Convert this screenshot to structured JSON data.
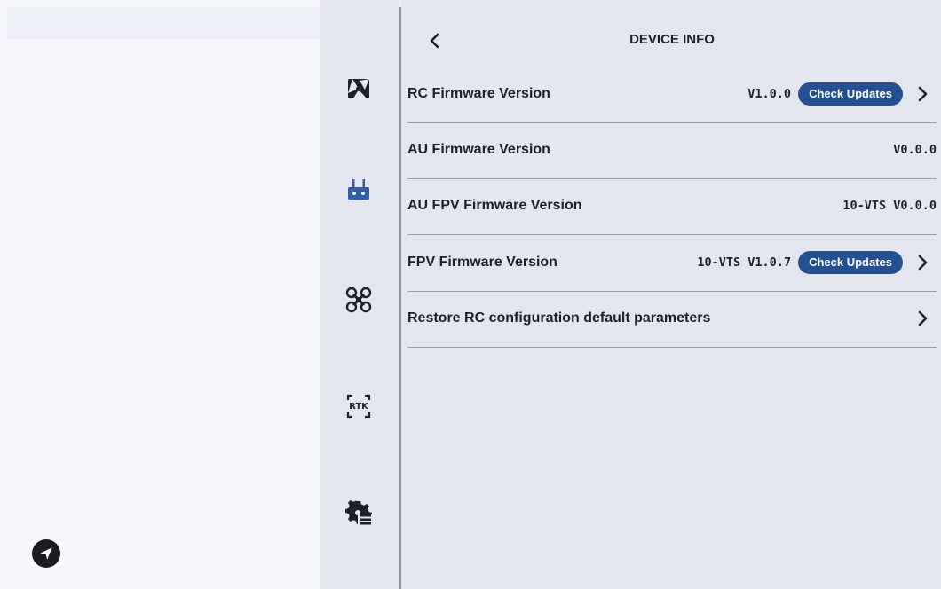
{
  "header": {
    "title": "DEVICE INFO",
    "back_icon": "chevron-left-icon"
  },
  "rail": {
    "items": [
      {
        "icon": "aircraft-camera-icon",
        "active": false
      },
      {
        "icon": "remote-controller-icon",
        "active": true
      },
      {
        "icon": "drone-icon",
        "active": false
      },
      {
        "icon": "rtk-icon",
        "label": "RTK",
        "active": false
      },
      {
        "icon": "settings-list-icon",
        "active": false
      }
    ]
  },
  "rows": [
    {
      "label": "RC Firmware Version",
      "value": "V1.0.0",
      "action": "Check Updates",
      "chevron": true
    },
    {
      "label": "AU Firmware Version",
      "value": "V0.0.0"
    },
    {
      "label": "AU FPV Firmware Version",
      "value": "10-VTS V0.0.0"
    },
    {
      "label": "FPV Firmware Version",
      "value": "10-VTS V1.0.7",
      "action": "Check Updates",
      "chevron": true
    },
    {
      "label": "Restore RC configuration default parameters",
      "chevron": true
    }
  ],
  "left_panel": {
    "send_icon": "send-icon"
  },
  "colors": {
    "accent": "#244f91",
    "background": "#e3e6ef",
    "active_icon": "#2f5ea6"
  }
}
